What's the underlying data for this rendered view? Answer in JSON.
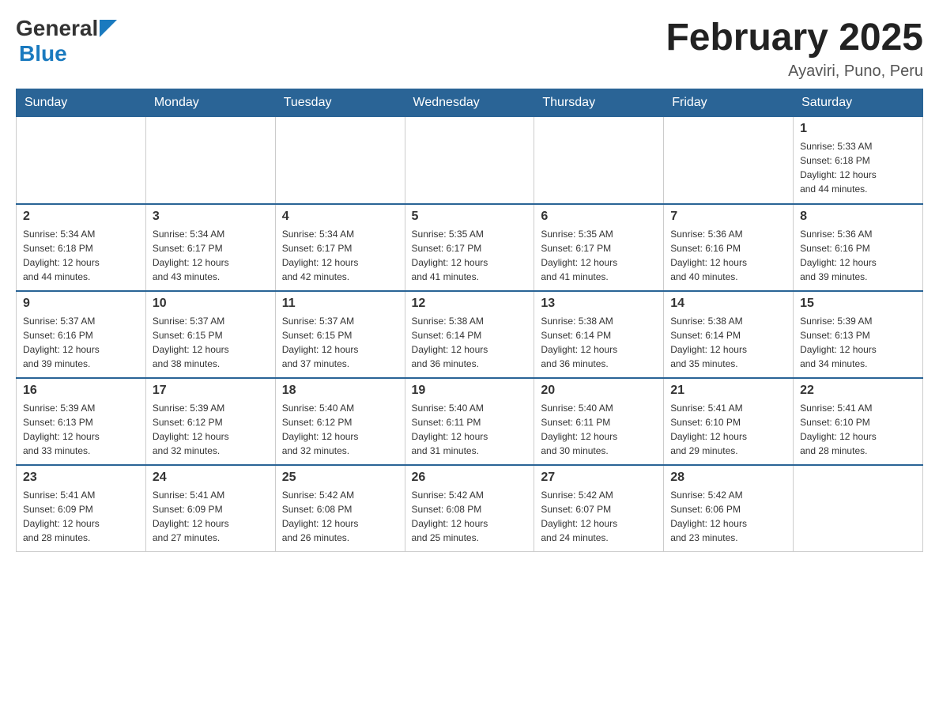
{
  "header": {
    "logo_general": "General",
    "logo_blue": "Blue",
    "title": "February 2025",
    "location": "Ayaviri, Puno, Peru"
  },
  "weekdays": [
    "Sunday",
    "Monday",
    "Tuesday",
    "Wednesday",
    "Thursday",
    "Friday",
    "Saturday"
  ],
  "weeks": [
    [
      {
        "day": "",
        "info": ""
      },
      {
        "day": "",
        "info": ""
      },
      {
        "day": "",
        "info": ""
      },
      {
        "day": "",
        "info": ""
      },
      {
        "day": "",
        "info": ""
      },
      {
        "day": "",
        "info": ""
      },
      {
        "day": "1",
        "info": "Sunrise: 5:33 AM\nSunset: 6:18 PM\nDaylight: 12 hours\nand 44 minutes."
      }
    ],
    [
      {
        "day": "2",
        "info": "Sunrise: 5:34 AM\nSunset: 6:18 PM\nDaylight: 12 hours\nand 44 minutes."
      },
      {
        "day": "3",
        "info": "Sunrise: 5:34 AM\nSunset: 6:17 PM\nDaylight: 12 hours\nand 43 minutes."
      },
      {
        "day": "4",
        "info": "Sunrise: 5:34 AM\nSunset: 6:17 PM\nDaylight: 12 hours\nand 42 minutes."
      },
      {
        "day": "5",
        "info": "Sunrise: 5:35 AM\nSunset: 6:17 PM\nDaylight: 12 hours\nand 41 minutes."
      },
      {
        "day": "6",
        "info": "Sunrise: 5:35 AM\nSunset: 6:17 PM\nDaylight: 12 hours\nand 41 minutes."
      },
      {
        "day": "7",
        "info": "Sunrise: 5:36 AM\nSunset: 6:16 PM\nDaylight: 12 hours\nand 40 minutes."
      },
      {
        "day": "8",
        "info": "Sunrise: 5:36 AM\nSunset: 6:16 PM\nDaylight: 12 hours\nand 39 minutes."
      }
    ],
    [
      {
        "day": "9",
        "info": "Sunrise: 5:37 AM\nSunset: 6:16 PM\nDaylight: 12 hours\nand 39 minutes."
      },
      {
        "day": "10",
        "info": "Sunrise: 5:37 AM\nSunset: 6:15 PM\nDaylight: 12 hours\nand 38 minutes."
      },
      {
        "day": "11",
        "info": "Sunrise: 5:37 AM\nSunset: 6:15 PM\nDaylight: 12 hours\nand 37 minutes."
      },
      {
        "day": "12",
        "info": "Sunrise: 5:38 AM\nSunset: 6:14 PM\nDaylight: 12 hours\nand 36 minutes."
      },
      {
        "day": "13",
        "info": "Sunrise: 5:38 AM\nSunset: 6:14 PM\nDaylight: 12 hours\nand 36 minutes."
      },
      {
        "day": "14",
        "info": "Sunrise: 5:38 AM\nSunset: 6:14 PM\nDaylight: 12 hours\nand 35 minutes."
      },
      {
        "day": "15",
        "info": "Sunrise: 5:39 AM\nSunset: 6:13 PM\nDaylight: 12 hours\nand 34 minutes."
      }
    ],
    [
      {
        "day": "16",
        "info": "Sunrise: 5:39 AM\nSunset: 6:13 PM\nDaylight: 12 hours\nand 33 minutes."
      },
      {
        "day": "17",
        "info": "Sunrise: 5:39 AM\nSunset: 6:12 PM\nDaylight: 12 hours\nand 32 minutes."
      },
      {
        "day": "18",
        "info": "Sunrise: 5:40 AM\nSunset: 6:12 PM\nDaylight: 12 hours\nand 32 minutes."
      },
      {
        "day": "19",
        "info": "Sunrise: 5:40 AM\nSunset: 6:11 PM\nDaylight: 12 hours\nand 31 minutes."
      },
      {
        "day": "20",
        "info": "Sunrise: 5:40 AM\nSunset: 6:11 PM\nDaylight: 12 hours\nand 30 minutes."
      },
      {
        "day": "21",
        "info": "Sunrise: 5:41 AM\nSunset: 6:10 PM\nDaylight: 12 hours\nand 29 minutes."
      },
      {
        "day": "22",
        "info": "Sunrise: 5:41 AM\nSunset: 6:10 PM\nDaylight: 12 hours\nand 28 minutes."
      }
    ],
    [
      {
        "day": "23",
        "info": "Sunrise: 5:41 AM\nSunset: 6:09 PM\nDaylight: 12 hours\nand 28 minutes."
      },
      {
        "day": "24",
        "info": "Sunrise: 5:41 AM\nSunset: 6:09 PM\nDaylight: 12 hours\nand 27 minutes."
      },
      {
        "day": "25",
        "info": "Sunrise: 5:42 AM\nSunset: 6:08 PM\nDaylight: 12 hours\nand 26 minutes."
      },
      {
        "day": "26",
        "info": "Sunrise: 5:42 AM\nSunset: 6:08 PM\nDaylight: 12 hours\nand 25 minutes."
      },
      {
        "day": "27",
        "info": "Sunrise: 5:42 AM\nSunset: 6:07 PM\nDaylight: 12 hours\nand 24 minutes."
      },
      {
        "day": "28",
        "info": "Sunrise: 5:42 AM\nSunset: 6:06 PM\nDaylight: 12 hours\nand 23 minutes."
      },
      {
        "day": "",
        "info": ""
      }
    ]
  ]
}
